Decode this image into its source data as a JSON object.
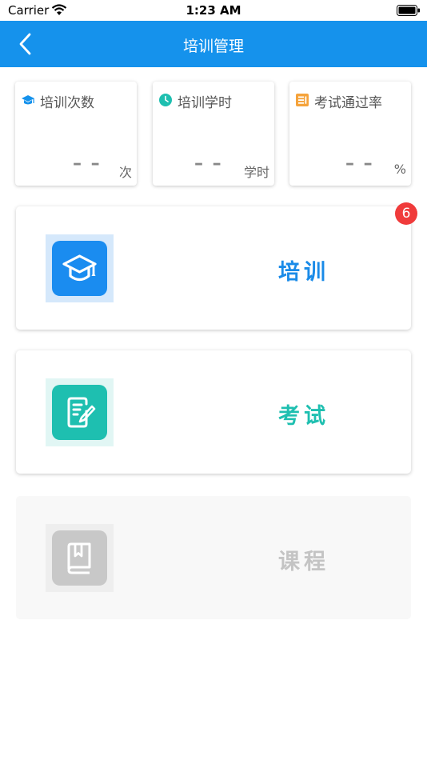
{
  "status_bar": {
    "carrier": "Carrier",
    "time": "1:23 AM"
  },
  "nav": {
    "title": "培训管理"
  },
  "stats": [
    {
      "label": "培训次数",
      "value": "– –",
      "unit": "次",
      "icon": "graduation-cap-icon",
      "color": "#1592ec"
    },
    {
      "label": "培训学时",
      "value": "– –",
      "unit": "学时",
      "icon": "clock-icon",
      "color": "#1ebfb0"
    },
    {
      "label": "考试通过率",
      "value": "– –",
      "unit": "%",
      "icon": "exam-list-icon",
      "color": "#f5a33b"
    }
  ],
  "entries": [
    {
      "label": "培训",
      "color": "#1a8be8",
      "badge": "6",
      "icon": "graduation-cap-icon"
    },
    {
      "label": "考试",
      "color": "#1ebfb0",
      "icon": "edit-document-icon"
    },
    {
      "label": "课程",
      "color": "#c4c4c4",
      "icon": "book-icon"
    }
  ]
}
